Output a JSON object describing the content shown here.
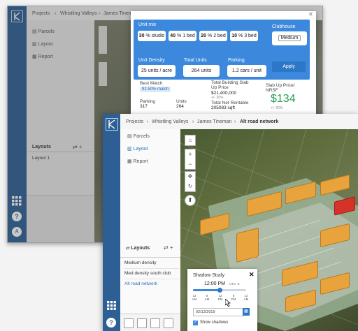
{
  "back": {
    "breadcrumb": {
      "projects": "Projects",
      "valley": "Whistling Valleys",
      "person": "James Tineman"
    },
    "nav": [
      "Parcels",
      "Layout",
      "Report"
    ],
    "layouts_title": "Layouts",
    "layouts": [
      "Layout 1"
    ]
  },
  "unitmix": {
    "unit_mix_label": "Unit mix",
    "studio": {
      "value": "30",
      "label": "% studio"
    },
    "one_bed": {
      "value": "40",
      "label": "% 1 bed"
    },
    "two_bed": {
      "value": "20",
      "label": "% 2 bed"
    },
    "three_bed": {
      "value": "10",
      "label": "% 3 bed"
    },
    "clubhouse_label": "Clubhouse",
    "clubhouse_value": "Medium",
    "density_label": "Unit Density",
    "density_value": "25",
    "density_unit": "units / acre",
    "total_units_label": "Total Units",
    "total_units_value": "264",
    "total_units_unit": "units",
    "parking_label": "Parking",
    "parking_value": "1.2 cars / unit",
    "apply": "Apply",
    "best_match_label": "Best Match",
    "best_match_value": "92.50% match",
    "parking_stat_label": "Parking",
    "parking_stat_value": "317",
    "units_stat_label": "Units",
    "units_stat_value": "264",
    "slab_up_label": "Total Building Slab Up Price",
    "slab_up_value": "$21,400,000",
    "slab_up_range": "+/- 20%",
    "net_rentable_label": "Total Net Rentable",
    "net_rentable_value": "205083 sqft",
    "price_label": "Slab Up Price/ NRSF",
    "price_value": "$134",
    "price_range": "+/- 20%"
  },
  "front": {
    "breadcrumb": {
      "projects": "Projects",
      "valley": "Whistling Valleys",
      "person": "James Tineman",
      "current": "Alt road network"
    },
    "nav": [
      "Parcels",
      "Layout",
      "Report"
    ],
    "layouts_title": "Layouts",
    "layouts": [
      "Medium density",
      "Med density south club",
      "Alt road network"
    ]
  },
  "shadow": {
    "title": "Shadow Study",
    "time": "12:00 PM",
    "tz": "UTC -5",
    "ticks": [
      {
        "n": "12",
        "s": "AM"
      },
      {
        "n": "6",
        "s": "AM"
      },
      {
        "n": "12",
        "s": "PM"
      },
      {
        "n": "6",
        "s": "PM"
      },
      {
        "n": "12",
        "s": "AM"
      }
    ],
    "date": "02/13/2019",
    "show_label": "Show shadows",
    "time_fraction": 0.5
  },
  "colors": {
    "rail": "#2d5f94",
    "accent": "#3b88dc",
    "price": "#2a9d55",
    "building": "#e8a33c",
    "selected_building": "#d6322a"
  }
}
